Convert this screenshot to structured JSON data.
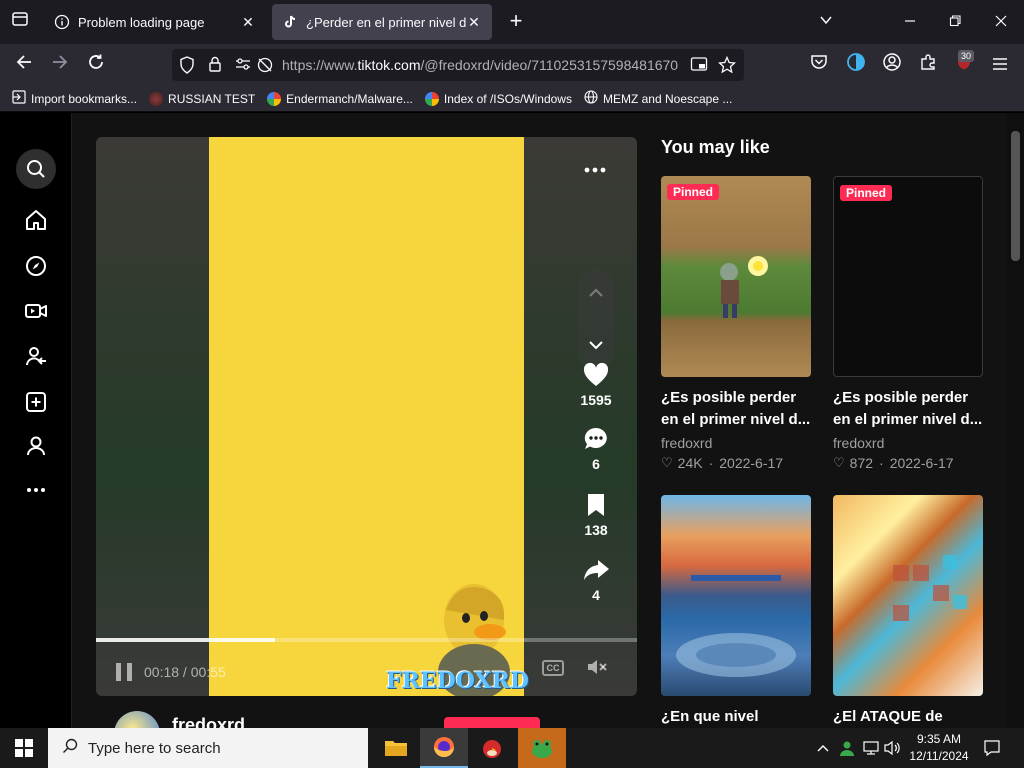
{
  "browser": {
    "tabs": [
      {
        "label": "Problem loading page",
        "icon": "info-icon"
      },
      {
        "label": "¿Perder en el primer nivel de Plants",
        "icon": "tiktok-icon"
      }
    ],
    "url_prefix": "https://www.",
    "url_domain": "tiktok.com",
    "url_rest": "/@fredoxrd/video/7110253157598481670",
    "extensions_badge": "30",
    "bookmarks": [
      {
        "label": "Import bookmarks...",
        "icon": "import-icon"
      },
      {
        "label": "RUSSIAN TEST",
        "icon": "globe-icon"
      },
      {
        "label": "Endermanch/Malware...",
        "icon": "google-icon"
      },
      {
        "label": "Index of /ISOs/Windows",
        "icon": "google-icon"
      },
      {
        "label": "MEMZ and Noescape ...",
        "icon": "globe-icon"
      }
    ]
  },
  "video": {
    "time": "00:18 / 00:55",
    "watermark": "FREDOXRD",
    "progress": 0.33,
    "cc_label": "CC",
    "likes": "1595",
    "comments": "6",
    "saves": "138",
    "shares": "4"
  },
  "author": {
    "name": "fredoxrd"
  },
  "recommendations": {
    "title": "You may like",
    "pinned_label": "Pinned",
    "cards": [
      {
        "title": "¿Es posible perder en el primer nivel d...",
        "author": "fredoxrd",
        "likes": "24K",
        "date": "2022-6-17",
        "pinned": true
      },
      {
        "title": "¿Es posible perder en el primer nivel d...",
        "author": "fredoxrd",
        "likes": "872",
        "date": "2022-6-17",
        "pinned": true
      },
      {
        "title": "¿En que nivel",
        "author": "",
        "likes": "",
        "date": "",
        "pinned": false
      },
      {
        "title": "¿El ATAQUE de",
        "author": "",
        "likes": "",
        "date": "",
        "pinned": false
      }
    ]
  },
  "taskbar": {
    "search_placeholder": "Type here to search",
    "time": "9:35 AM",
    "date": "12/11/2024"
  },
  "colors": {
    "accent": "#fe2c55",
    "tab_active": "#42414d",
    "toolbar": "#2b2a33"
  }
}
